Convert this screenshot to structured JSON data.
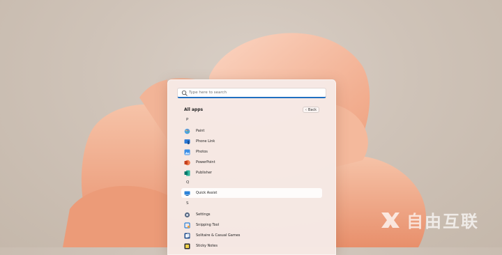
{
  "search": {
    "placeholder": "Type here to search"
  },
  "all_apps": {
    "heading": "All apps",
    "back_label": "Back"
  },
  "groups": [
    {
      "letter": "P",
      "apps": [
        "Paint",
        "Phone Link",
        "Photos",
        "PowerPoint",
        "Publisher"
      ]
    },
    {
      "letter": "Q",
      "apps": [
        "Quick Assist"
      ]
    },
    {
      "letter": "S",
      "apps": [
        "Settings",
        "Snipping Tool",
        "Solitaire & Casual Games",
        "Sticky Notes"
      ]
    }
  ],
  "selected_app": "Quick Assist",
  "icons": {
    "Paint": "paint-icon",
    "Phone Link": "phone-link-icon",
    "Photos": "photos-icon",
    "PowerPoint": "powerpoint-icon",
    "Publisher": "publisher-icon",
    "Quick Assist": "quick-assist-icon",
    "Settings": "settings-icon",
    "Snipping Tool": "snipping-tool-icon",
    "Solitaire & Casual Games": "solitaire-icon",
    "Sticky Notes": "sticky-notes-icon"
  },
  "watermark": {
    "text": "自由互联"
  },
  "colors": {
    "accent": "#1f6fc1",
    "bloom": "#f0a98a",
    "panel": "#f8eae5"
  }
}
